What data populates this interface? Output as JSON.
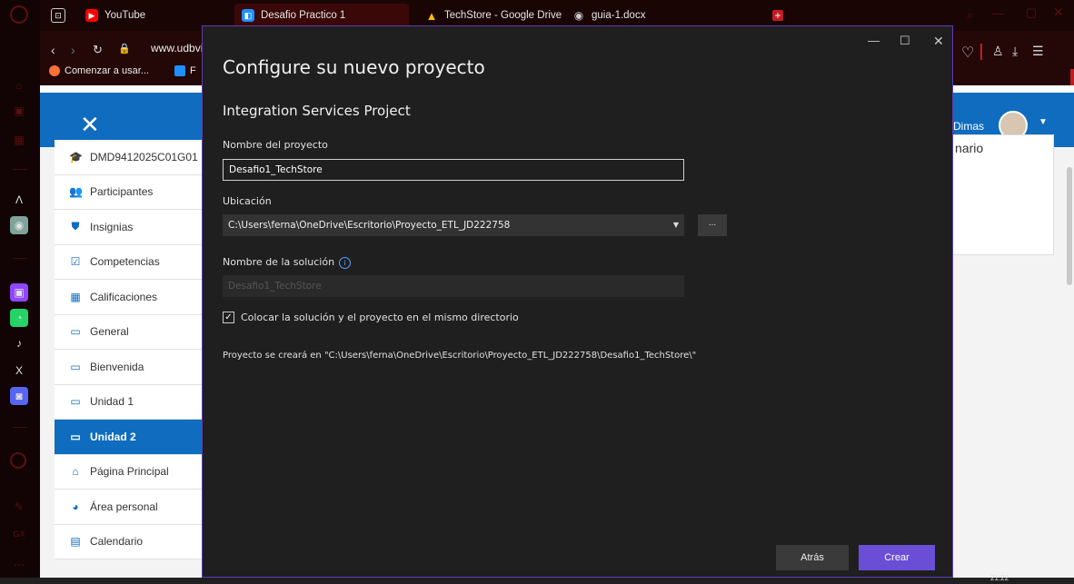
{
  "browser": {
    "tabs": [
      {
        "label": "YouTube",
        "icon": "youtube-icon",
        "color": "#ff0000"
      },
      {
        "label": "Desafio Practico 1",
        "icon": "visual-studio-icon",
        "color": "#1e90ff"
      },
      {
        "label": "TechStore - Google Drive",
        "icon": "google-drive-icon",
        "color": "#fbbc04"
      },
      {
        "label": "guia-1.docx",
        "icon": "globe-icon",
        "color": "#cccccc"
      }
    ],
    "url": "www.udbvi",
    "bookmarks": [
      "Comenzar a usar...",
      "F"
    ]
  },
  "site": {
    "user_name": "Dimas",
    "right_block_text": "nario"
  },
  "course_nav": {
    "items": [
      {
        "label": "DMD9412025C01G01",
        "icon": "graduation-cap-icon",
        "glyph": "🎓",
        "active": false
      },
      {
        "label": "Participantes",
        "icon": "users-icon",
        "glyph": "👥",
        "active": false
      },
      {
        "label": "Insignias",
        "icon": "shield-icon",
        "glyph": "⛊",
        "active": false
      },
      {
        "label": "Competencias",
        "icon": "checkbox-icon",
        "glyph": "☑",
        "active": false
      },
      {
        "label": "Calificaciones",
        "icon": "table-icon",
        "glyph": "▦",
        "active": false
      },
      {
        "label": "General",
        "icon": "folder-icon",
        "glyph": "▭",
        "active": false
      },
      {
        "label": "Bienvenida",
        "icon": "folder-icon",
        "glyph": "▭",
        "active": false
      },
      {
        "label": "Unidad 1",
        "icon": "folder-icon",
        "glyph": "▭",
        "active": false
      },
      {
        "label": "Unidad 2",
        "icon": "folder-icon",
        "glyph": "▭",
        "active": true
      },
      {
        "label": "Página Principal",
        "icon": "home-icon",
        "glyph": "⌂",
        "active": false
      },
      {
        "label": "Área personal",
        "icon": "dashboard-icon",
        "glyph": "◕",
        "active": false
      },
      {
        "label": "Calendario",
        "icon": "calendar-icon",
        "glyph": "▤",
        "active": false
      }
    ]
  },
  "dialog": {
    "title": "Configure su nuevo proyecto",
    "project_type": "Integration Services Project",
    "name_label": "Nombre del proyecto",
    "name_value": "Desafio1_TechStore",
    "location_label": "Ubicación",
    "location_value": "C:\\Users\\ferna\\OneDrive\\Escritorio\\Proyecto_ETL_JD222758",
    "browse_label": "...",
    "solution_label": "Nombre de la solución",
    "solution_value": "Desafio1_TechStore",
    "same_dir_label": "Colocar la solución y el proyecto en el mismo directorio",
    "same_dir_checked": true,
    "path_note": "Proyecto se creará en \"C:\\Users\\ferna\\OneDrive\\Escritorio\\Proyecto_ETL_JD222758\\Desafio1_TechStore\\\"",
    "back_label": "Atrás",
    "create_label": "Crear",
    "accent_color": "#6a4fd6"
  },
  "taskbar": {
    "time": "21:22"
  }
}
